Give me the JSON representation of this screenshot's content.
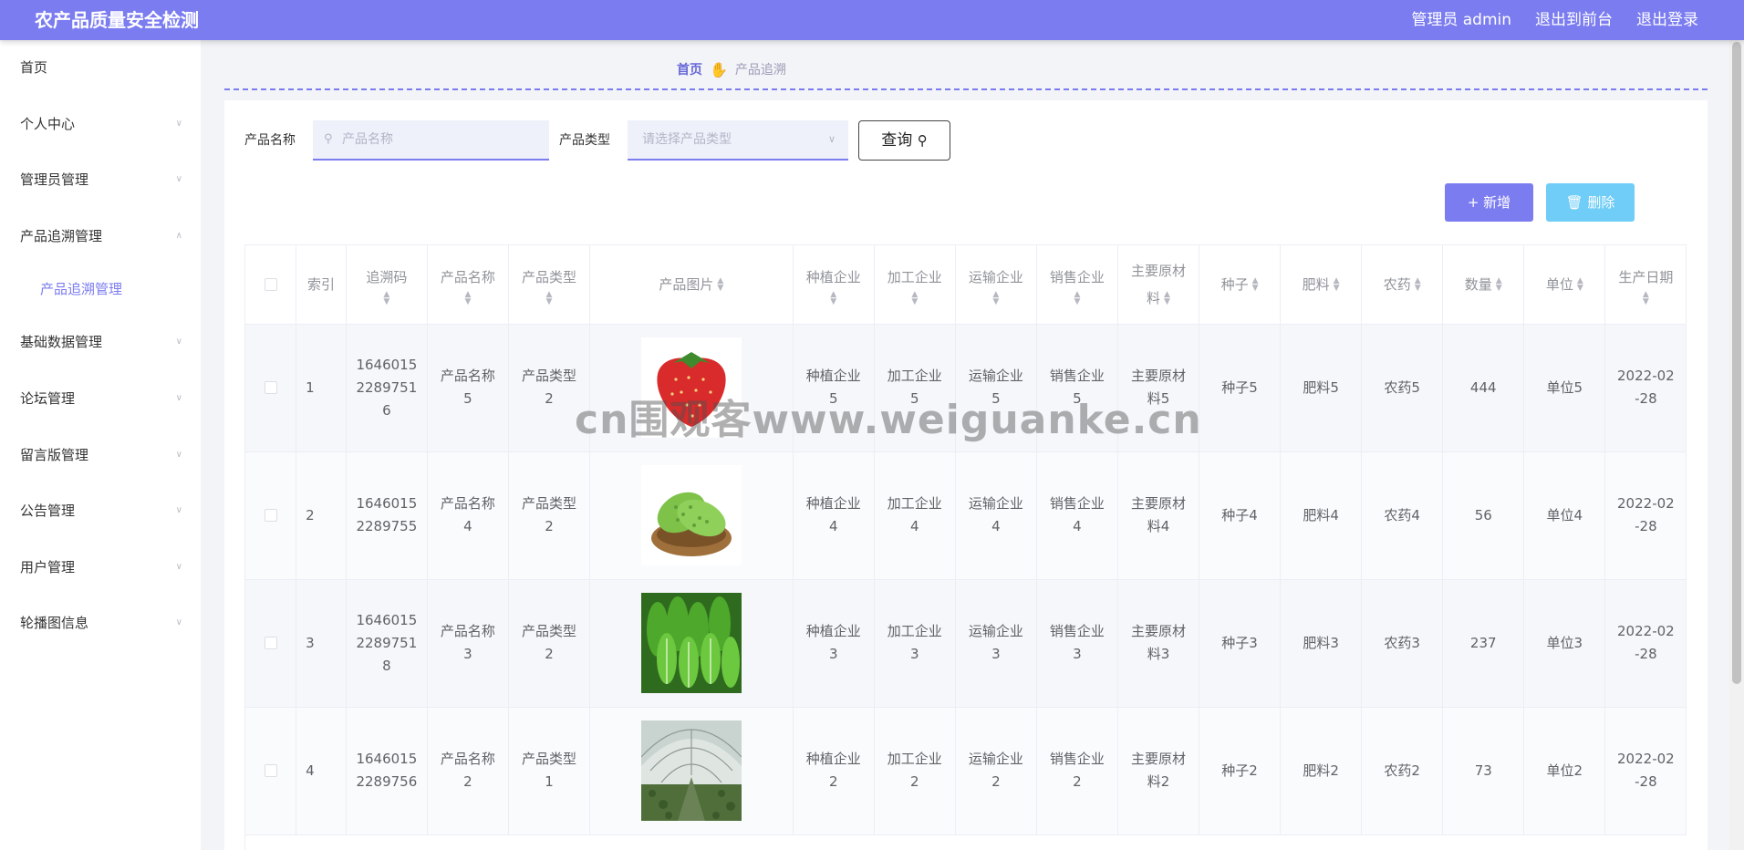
{
  "app": {
    "title": "农产品质量安全检测"
  },
  "header": {
    "user_label": "管理员 admin",
    "front_label": "退出到前台",
    "logout_label": "退出登录"
  },
  "sidebar": {
    "items": [
      {
        "label": "首页"
      },
      {
        "label": "个人中心"
      },
      {
        "label": "管理员管理"
      },
      {
        "label": "产品追溯管理"
      },
      {
        "label": "基础数据管理"
      },
      {
        "label": "论坛管理"
      },
      {
        "label": "留言版管理"
      },
      {
        "label": "公告管理"
      },
      {
        "label": "用户管理"
      },
      {
        "label": "轮播图信息"
      }
    ],
    "sub_label": "产品追溯管理"
  },
  "breadcrumb": {
    "home": "首页",
    "current": "产品追溯"
  },
  "search": {
    "name_label": "产品名称",
    "name_placeholder": "产品名称",
    "type_label": "产品类型",
    "type_placeholder": "请选择产品类型",
    "query_label": "查询"
  },
  "actions": {
    "add_label": "新增",
    "delete_label": "删除"
  },
  "table": {
    "headers": [
      "索引",
      "追溯码",
      "产品名称",
      "产品类型",
      "产品图片",
      "种植企业",
      "加工企业",
      "运输企业",
      "销售企业",
      "主要原材料",
      "种子",
      "肥料",
      "农药",
      "数量",
      "单位",
      "生产日期"
    ],
    "rows": [
      {
        "index": "1",
        "code": "16460152289751 6",
        "name": "产品名称5",
        "type": "产品类型2",
        "image": "strawberry",
        "plant": "种植企业5",
        "process": "加工企业5",
        "transport": "运输企业5",
        "sales": "销售企业5",
        "material": "主要原材料5",
        "seed": "种子5",
        "fertilizer": "肥料5",
        "pesticide": "农药5",
        "qty": "444",
        "unit": "单位5",
        "date": "2022-02-28"
      },
      {
        "index": "2",
        "code": "16460152289755",
        "name": "产品名称4",
        "type": "产品类型2",
        "image": "bitter-melon",
        "plant": "种植企业4",
        "process": "加工企业4",
        "transport": "运输企业4",
        "sales": "销售企业4",
        "material": "主要原材料4",
        "seed": "种子4",
        "fertilizer": "肥料4",
        "pesticide": "农药4",
        "qty": "56",
        "unit": "单位4",
        "date": "2022-02-28"
      },
      {
        "index": "3",
        "code": "16460152289751 8",
        "name": "产品名称3",
        "type": "产品类型2",
        "image": "leafy-greens",
        "plant": "种植企业3",
        "process": "加工企业3",
        "transport": "运输企业3",
        "sales": "销售企业3",
        "material": "主要原材料3",
        "seed": "种子3",
        "fertilizer": "肥料3",
        "pesticide": "农药3",
        "qty": "237",
        "unit": "单位3",
        "date": "2022-02-28"
      },
      {
        "index": "4",
        "code": "16460152289756",
        "name": "产品名称2",
        "type": "产品类型1",
        "image": "greenhouse",
        "plant": "种植企业2",
        "process": "加工企业2",
        "transport": "运输企业2",
        "sales": "销售企业2",
        "material": "主要原材料2",
        "seed": "种子2",
        "fertilizer": "肥料2",
        "pesticide": "农药2",
        "qty": "73",
        "unit": "单位2",
        "date": "2022-02-28"
      }
    ]
  },
  "watermark": "cn围观客www.weiguanke.cn",
  "colors": {
    "primary": "#7b7cf0",
    "info": "#6fcdf7",
    "header_bg": "#7b7cf0"
  }
}
